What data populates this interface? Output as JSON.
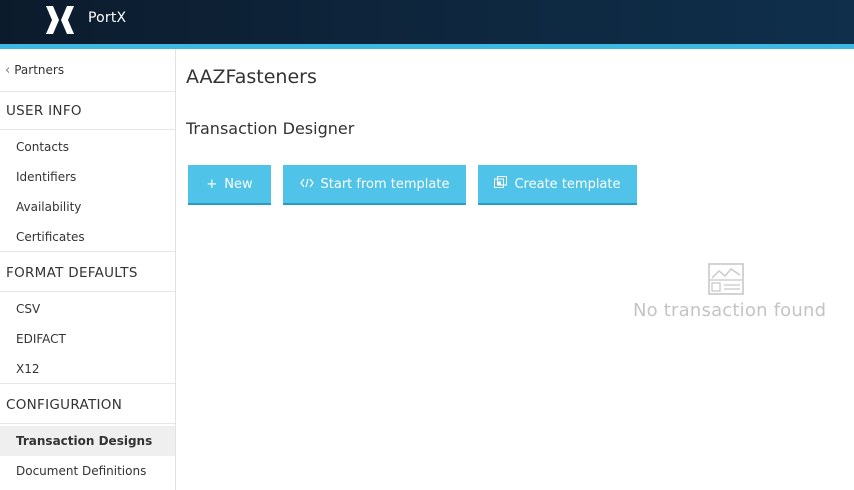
{
  "app": {
    "brand": "PortX"
  },
  "sidebar": {
    "back_label": "Partners",
    "sections": [
      {
        "title": "USER INFO",
        "items": [
          "Contacts",
          "Identifiers",
          "Availability",
          "Certificates"
        ]
      },
      {
        "title": "FORMAT DEFAULTS",
        "items": [
          "CSV",
          "EDIFACT",
          "X12"
        ]
      },
      {
        "title": "CONFIGURATION",
        "items": [
          "Transaction Designs",
          "Document Definitions"
        ]
      }
    ],
    "active_item": "Transaction Designs"
  },
  "main": {
    "title": "AAZFasteners",
    "subtitle": "Transaction Designer",
    "buttons": {
      "new": "New",
      "start_from_template": "Start from template",
      "create_template": "Create template"
    },
    "empty_state": {
      "text": "No transaction found",
      "icon": "image-placeholder-icon"
    }
  },
  "colors": {
    "topbar": "#0e2840",
    "accent": "#3bb9e3",
    "button": "#4fc3e8",
    "empty_text": "#c4c4c4"
  }
}
